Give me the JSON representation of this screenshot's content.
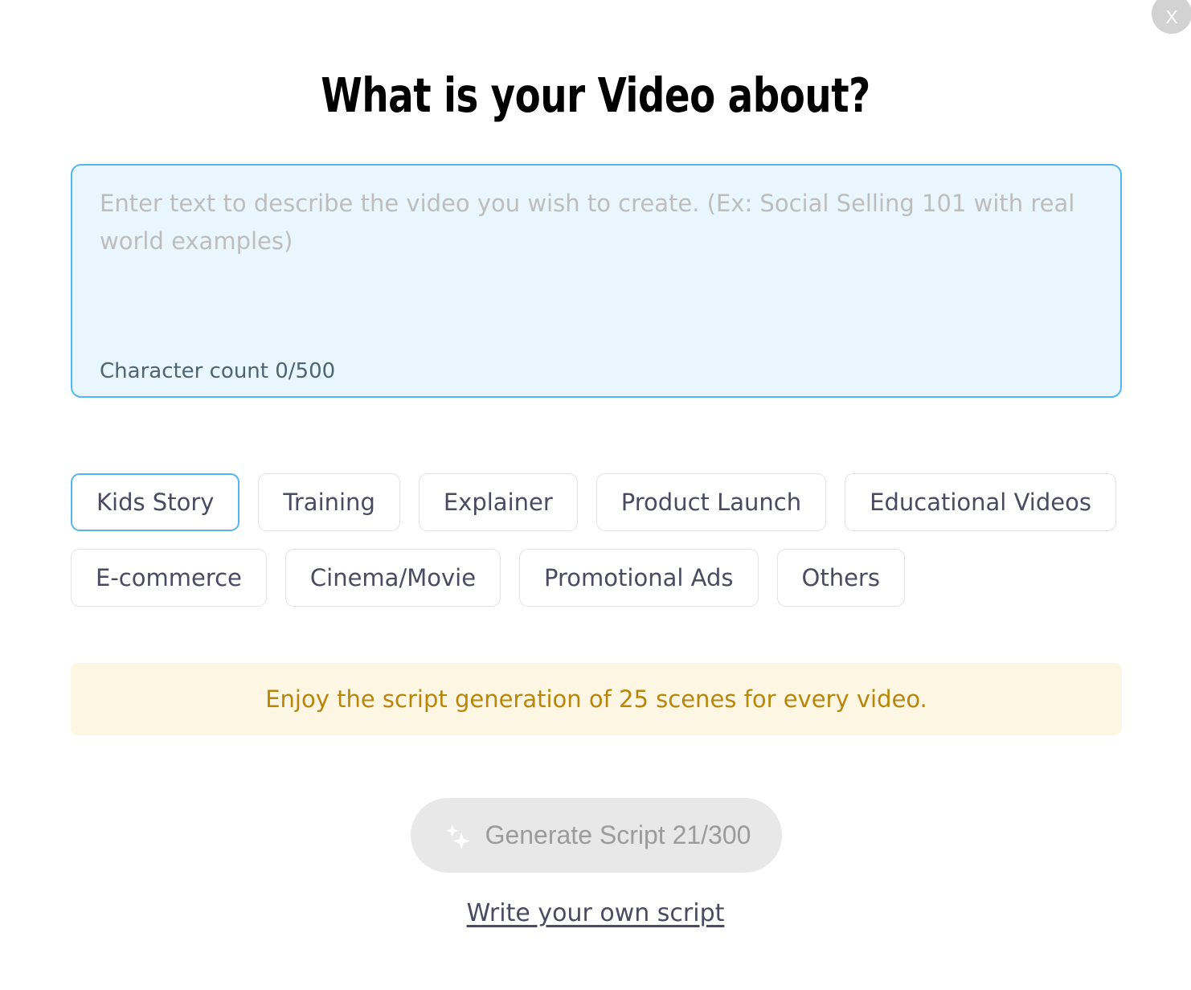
{
  "window": {
    "close_label": "X"
  },
  "header": {
    "title": "What is your Video about?"
  },
  "prompt": {
    "placeholder": "Enter text to describe the video you wish to create. (Ex: Social Selling 101 with real world examples)",
    "value": "",
    "char_count_label": "Character count 0/500",
    "max_chars": 500,
    "current_chars": 0,
    "border_color": "#54b6ef",
    "background_color": "#e9f6fd"
  },
  "categories": {
    "selected": "Kids Story",
    "chips": [
      {
        "label": "Kids Story",
        "selected": true
      },
      {
        "label": "Training",
        "selected": false
      },
      {
        "label": "Explainer",
        "selected": false
      },
      {
        "label": "Product Launch",
        "selected": false
      },
      {
        "label": "Educational Videos",
        "selected": false
      },
      {
        "label": "E-commerce",
        "selected": false
      },
      {
        "label": "Cinema/Movie",
        "selected": false
      },
      {
        "label": "Promotional Ads",
        "selected": false
      },
      {
        "label": "Others",
        "selected": false
      }
    ]
  },
  "notice": {
    "text": "Enjoy the script generation of 25 scenes for every video.",
    "text_color": "#b8860b",
    "background_color": "#fdf6e3"
  },
  "actions": {
    "generate_label": "Generate Script 21/300",
    "generate_icon": "sparkle-icon",
    "generate_used": 21,
    "generate_total": 300,
    "generate_disabled": true,
    "write_own_script_label": "Write your own script"
  }
}
